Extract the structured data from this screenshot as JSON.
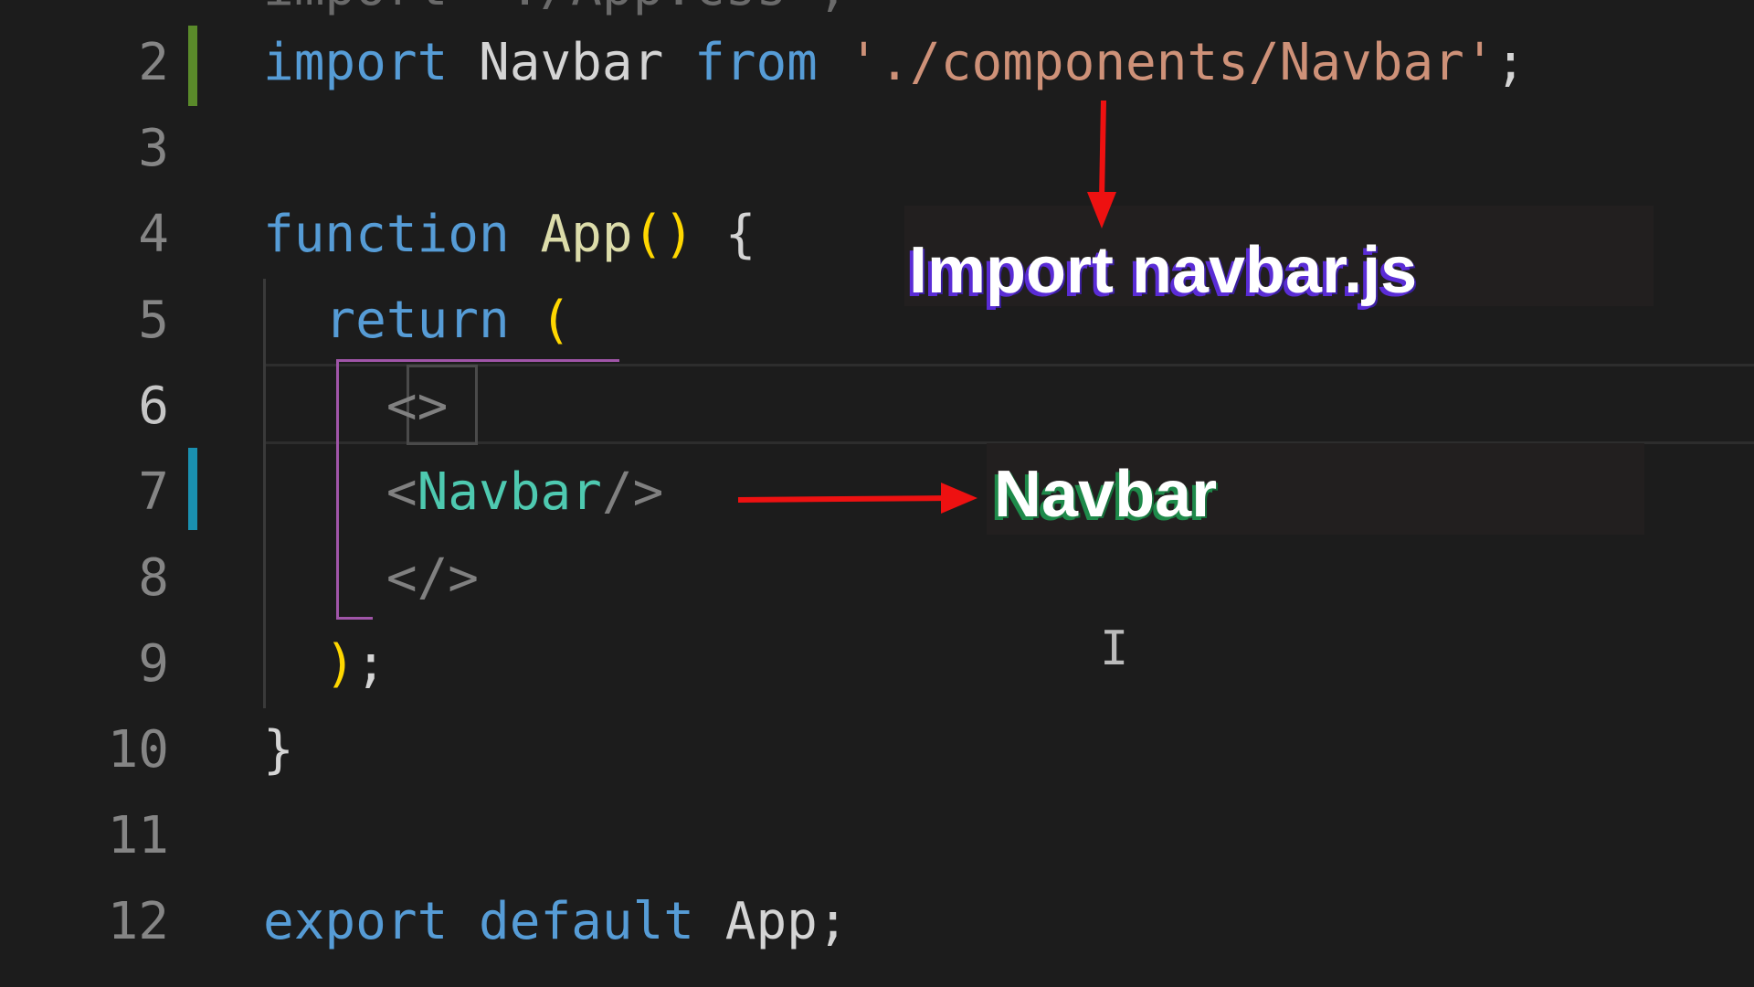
{
  "editor": {
    "top_fragment": "import './App.css';",
    "lines": [
      {
        "number": "2",
        "tokens": [
          {
            "t": "import",
            "c": "kw"
          },
          {
            "t": " Navbar ",
            "c": "id"
          },
          {
            "t": "from",
            "c": "kw"
          },
          {
            "t": " ",
            "c": "id"
          },
          {
            "t": "'./components/Navbar'",
            "c": "str"
          },
          {
            "t": ";",
            "c": "id"
          }
        ]
      },
      {
        "number": "3",
        "tokens": []
      },
      {
        "number": "4",
        "tokens": [
          {
            "t": "function",
            "c": "kw"
          },
          {
            "t": " ",
            "c": "id"
          },
          {
            "t": "App",
            "c": "fn"
          },
          {
            "t": "()",
            "c": "brk"
          },
          {
            "t": " {",
            "c": "id"
          }
        ]
      },
      {
        "number": "5",
        "tokens": [
          {
            "t": "  return",
            "c": "kw"
          },
          {
            "t": " (",
            "c": "brk"
          }
        ]
      },
      {
        "number": "6",
        "tokens": [
          {
            "t": "    <>",
            "c": "tagp"
          }
        ]
      },
      {
        "number": "7",
        "tokens": [
          {
            "t": "    <",
            "c": "tagp"
          },
          {
            "t": "Navbar",
            "c": "comp"
          },
          {
            "t": "/>",
            "c": "tagp"
          }
        ]
      },
      {
        "number": "8",
        "tokens": [
          {
            "t": "    </>",
            "c": "tagp"
          }
        ]
      },
      {
        "number": "9",
        "tokens": [
          {
            "t": "  )",
            "c": "brk"
          },
          {
            "t": ";",
            "c": "id"
          }
        ]
      },
      {
        "number": "10",
        "tokens": [
          {
            "t": "}",
            "c": "id"
          }
        ]
      },
      {
        "number": "11",
        "tokens": []
      },
      {
        "number": "12",
        "tokens": [
          {
            "t": "export",
            "c": "kw"
          },
          {
            "t": " ",
            "c": "id"
          },
          {
            "t": "default",
            "c": "kw"
          },
          {
            "t": " App;",
            "c": "id"
          }
        ]
      }
    ],
    "current_line": "6"
  },
  "annotations": {
    "import_label": "Import navbar.js",
    "navbar_label": "Navbar"
  },
  "colors": {
    "background": "#1c1c1c",
    "keyword": "#569cd6",
    "string": "#ce9178",
    "bracket": "#ffd700",
    "component": "#4ec9b0",
    "arrow": "#ee1111",
    "git_added": "#5a8a2a",
    "git_modified": "#1a90b0"
  }
}
